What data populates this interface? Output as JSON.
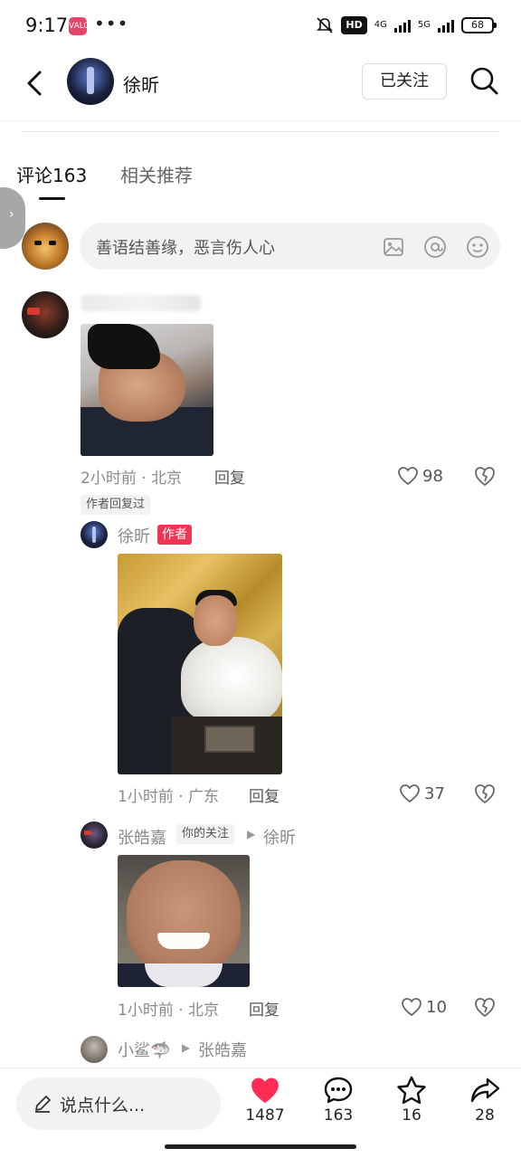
{
  "status_bar": {
    "time": "9:17",
    "app_icon": "VALOR",
    "dots": "•••",
    "hd_label": "HD",
    "net_4g": "4G",
    "net_5g": "5G",
    "battery": "68"
  },
  "header": {
    "user_name": "徐昕",
    "follow_label": "已关注"
  },
  "tabs": [
    {
      "label": "评论163"
    },
    {
      "label": "相关推荐"
    }
  ],
  "comment_input": {
    "placeholder": "善语结善缘，恶言伤人心"
  },
  "comment": {
    "time_location": "2小时前 · 北京",
    "reply_label": "回复",
    "likes": "98",
    "author_replied_tag": "作者回复过"
  },
  "replies": [
    {
      "name": "徐昕",
      "badge": "作者",
      "time_location": "1小时前 · 广东",
      "reply_label": "回复",
      "likes": "37"
    },
    {
      "name": "张皓嘉",
      "tag": "你的关注",
      "reply_to": "徐昕",
      "time_location": "1小时前 · 北京",
      "reply_label": "回复",
      "likes": "10"
    },
    {
      "name": "小鲨🦈",
      "reply_to": "张皓嘉"
    }
  ],
  "bottom_bar": {
    "input_placeholder": "说点什么...",
    "like_count": "1487",
    "comment_count": "163",
    "favorite_count": "16",
    "share_count": "28"
  },
  "colors": {
    "accent_red": "#ee3554",
    "like_red": "#ff2d55",
    "muted_text": "#8a8a8a"
  }
}
